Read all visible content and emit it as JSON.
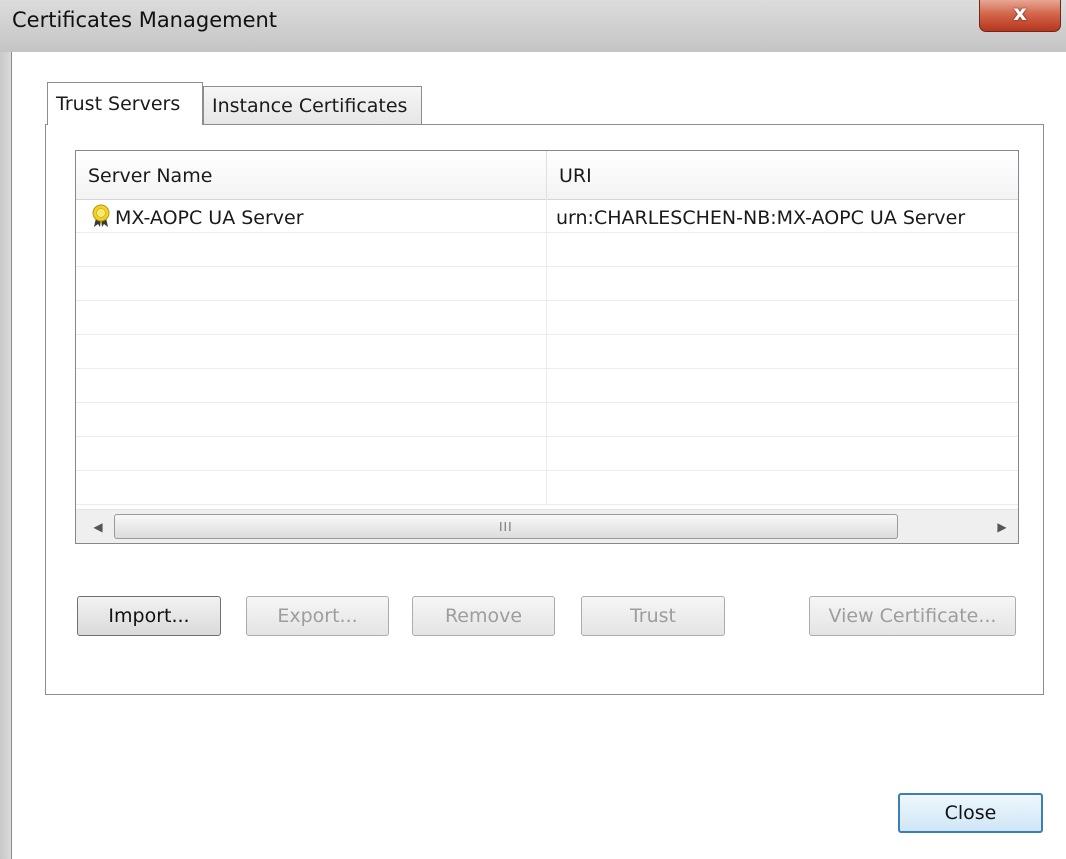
{
  "window": {
    "title": "Certificates Management",
    "close_glyph": "x"
  },
  "tabs": [
    {
      "label": "Trust Servers",
      "active": true
    },
    {
      "label": "Instance Certificates",
      "active": false
    }
  ],
  "list": {
    "columns": [
      "Server Name",
      "URI"
    ],
    "rows": [
      {
        "icon": "certificate-icon",
        "server_name": "MX-AOPC UA Server",
        "uri": "urn:CHARLESCHEN-NB:MX-AOPC UA Server"
      }
    ],
    "scrollbar_grip": "III"
  },
  "buttons": {
    "import": "Import...",
    "export": "Export...",
    "remove": "Remove",
    "trust": "Trust",
    "view_certificate": "View Certificate...",
    "close": "Close"
  },
  "colors": {
    "close_button": "#c8462b",
    "default_button_border": "#3c7fb1",
    "disabled_text": "#9d9d9d"
  }
}
